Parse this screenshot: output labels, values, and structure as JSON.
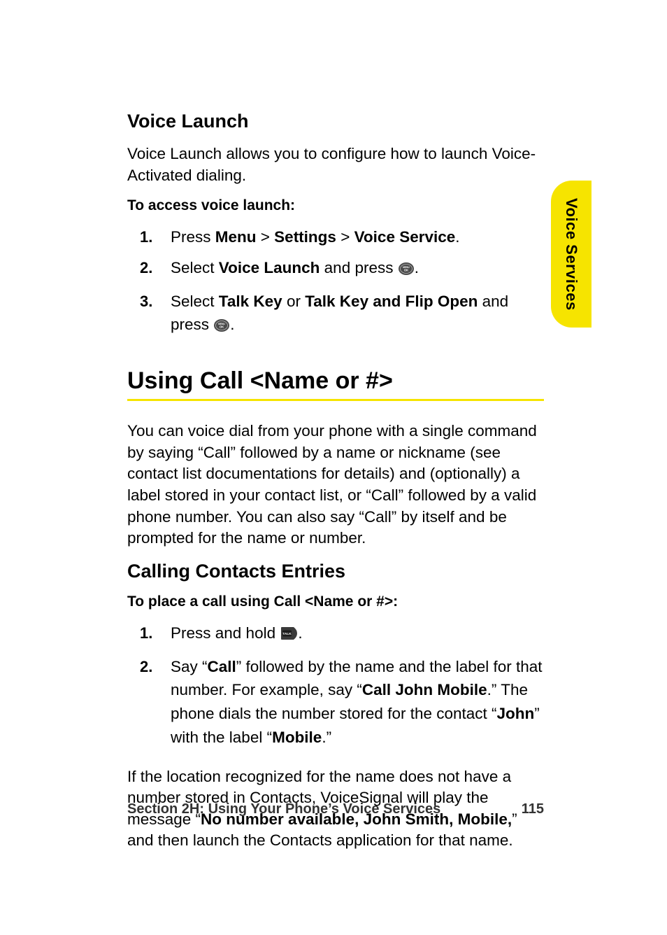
{
  "sideTab": "Voice Services",
  "section1": {
    "heading": "Voice Launch",
    "intro": "Voice Launch allows you to configure how to launch Voice-Activated dialing.",
    "lead": "To access voice launch:",
    "steps": {
      "s1": {
        "num": "1.",
        "press": "Press ",
        "menu": "Menu",
        "gt1": " > ",
        "settings": "Settings",
        "gt2": " > ",
        "voiceService": "Voice Service",
        "end": "."
      },
      "s2": {
        "num": "2.",
        "select": "Select ",
        "voiceLaunch": "Voice Launch",
        "andPress": " and press ",
        "end": "."
      },
      "s3": {
        "num": "3.",
        "select": "Select ",
        "talkKey": "Talk Key",
        "or": " or ",
        "talkKeyFlip": "Talk Key and Flip Open",
        "andPress": " and press ",
        "end": "."
      }
    }
  },
  "mainTitle": "Using Call <Name or #>",
  "mainIntro": "You can voice dial from your phone with a single command by saying “Call” followed by a name or nickname (see contact list documentations for details) and (optionally) a label stored in your contact list, or “Call” followed by a valid phone number. You can also say “Call” by itself and be prompted for the name or number.",
  "section2": {
    "heading": "Calling Contacts Entries",
    "lead": "To place a call using Call <Name or #>:",
    "steps": {
      "s1": {
        "num": "1.",
        "pressHold": "Press and hold ",
        "end": "."
      },
      "s2": {
        "num": "2.",
        "t1": "Say “",
        "call": "Call",
        "t2": "” followed by the name and the label for that number. For example, say “",
        "callJohnMobile": "Call John Mobile",
        "t3": ".” The phone dials the number stored for the contact “",
        "john": "John",
        "t4": "” with the label “",
        "mobile": "Mobile",
        "t5": ".”"
      }
    },
    "trail": {
      "t1": "If the location recognized for the name does not have a number stored in Contacts, VoiceSignal will play the message “",
      "msg": "No number available, John Smith, Mobile,",
      "t2": "” and then launch the Contacts application for that name."
    }
  },
  "footer": {
    "section": "Section 2H: Using Your Phone’s Voice Services",
    "page": "115"
  },
  "icons": {
    "ok": "MENU/OK key",
    "talk": "TALK key"
  }
}
